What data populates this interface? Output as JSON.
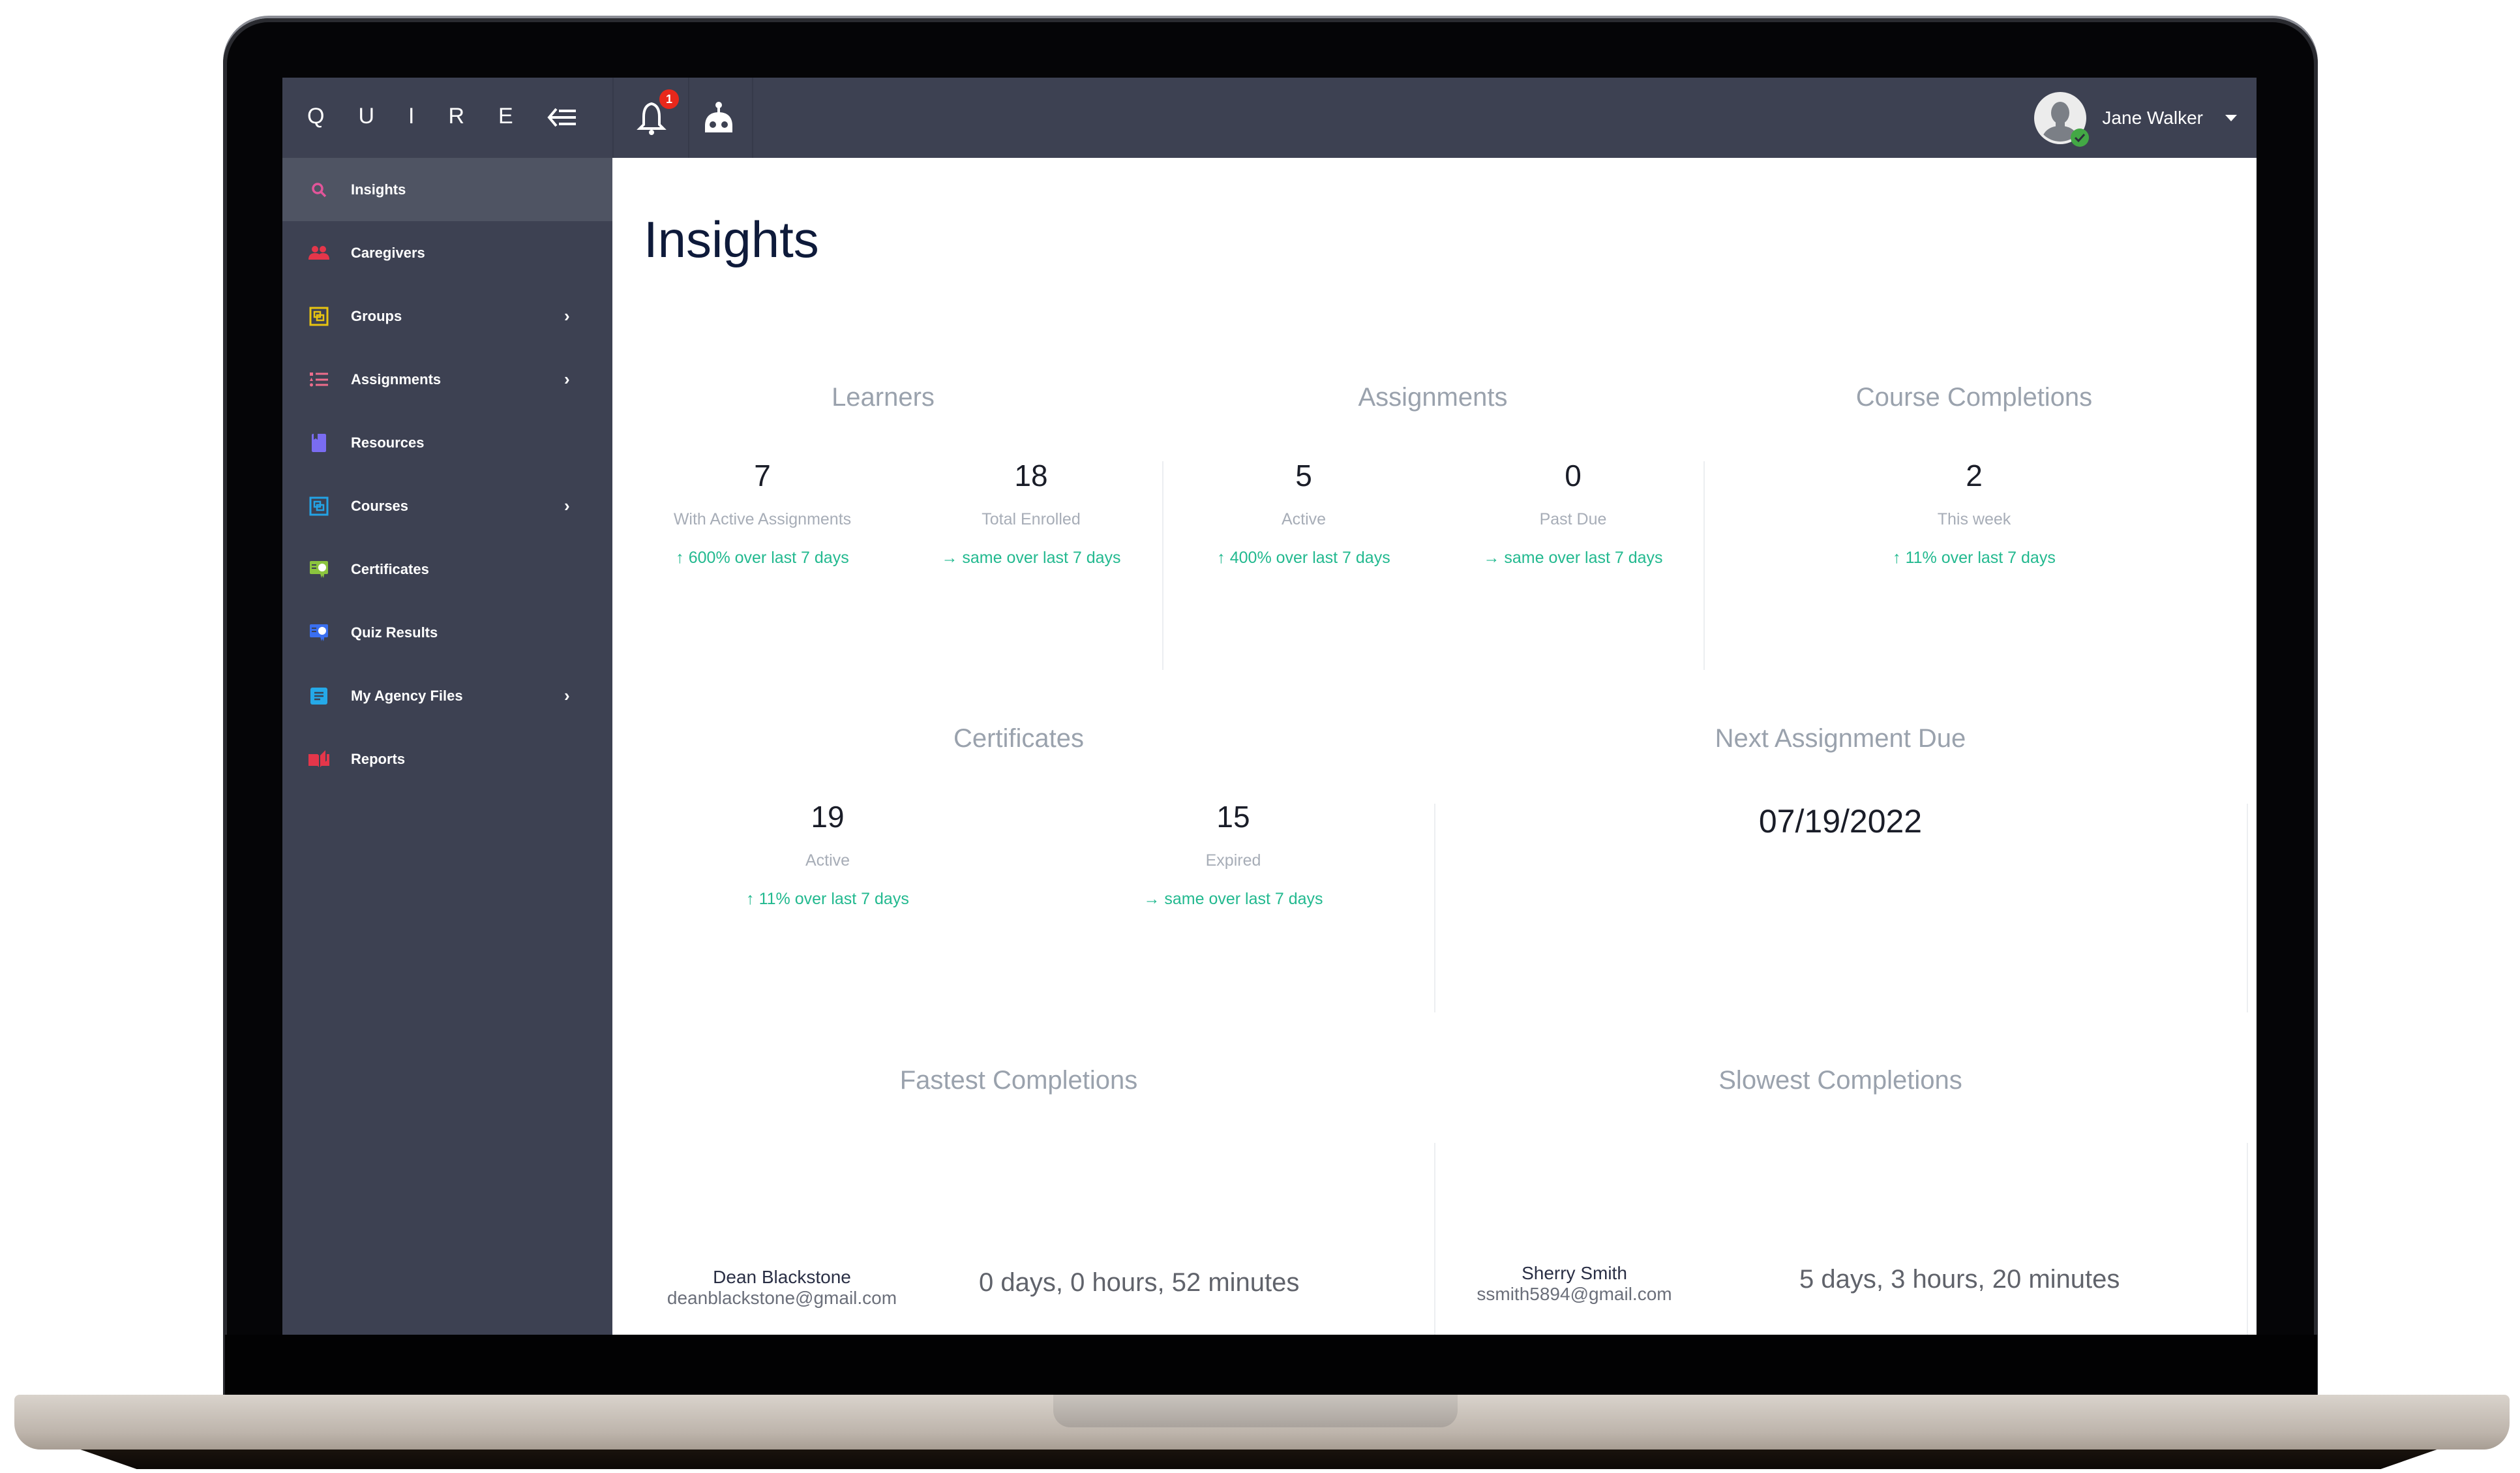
{
  "app": {
    "logo": "QUIRE",
    "notifications_count": "1",
    "user": {
      "name": "Jane Walker",
      "status": "online"
    }
  },
  "sidebar": {
    "items": [
      {
        "label": "Insights",
        "icon": "search-icon",
        "color": "#e2559a",
        "active": true,
        "has_submenu": false
      },
      {
        "label": "Caregivers",
        "icon": "people-icon",
        "color": "#e5364a",
        "active": false,
        "has_submenu": false
      },
      {
        "label": "Groups",
        "icon": "group-icon",
        "color": "#e8c410",
        "active": false,
        "has_submenu": true
      },
      {
        "label": "Assignments",
        "icon": "list-icon",
        "color": "#ee6d8c",
        "active": false,
        "has_submenu": true
      },
      {
        "label": "Resources",
        "icon": "bookmark-icon",
        "color": "#7a6cf2",
        "active": false,
        "has_submenu": false
      },
      {
        "label": "Courses",
        "icon": "course-icon",
        "color": "#23a3e6",
        "active": false,
        "has_submenu": true
      },
      {
        "label": "Certificates",
        "icon": "certificate-icon",
        "color": "#8bc43e",
        "active": false,
        "has_submenu": false
      },
      {
        "label": "Quiz Results",
        "icon": "quiz-icon",
        "color": "#3a6ff0",
        "active": false,
        "has_submenu": false
      },
      {
        "label": "My Agency Files",
        "icon": "file-icon",
        "color": "#25a9e8",
        "active": false,
        "has_submenu": true
      },
      {
        "label": "Reports",
        "icon": "book-icon",
        "color": "#e5364a",
        "active": false,
        "has_submenu": false
      }
    ]
  },
  "main": {
    "title": "Insights",
    "learners": {
      "title": "Learners",
      "stats": [
        {
          "value": "7",
          "label": "With Active Assignments",
          "trend": "600% over last 7 days",
          "trend_dir": "up"
        },
        {
          "value": "18",
          "label": "Total Enrolled",
          "trend": "same over last 7 days",
          "trend_dir": "same"
        }
      ]
    },
    "assignments": {
      "title": "Assignments",
      "stats": [
        {
          "value": "5",
          "label": "Active",
          "trend": "400% over last 7 days",
          "trend_dir": "up"
        },
        {
          "value": "0",
          "label": "Past Due",
          "trend": "same over last 7 days",
          "trend_dir": "same"
        }
      ]
    },
    "course_completions": {
      "title": "Course Completions",
      "stats": [
        {
          "value": "2",
          "label": "This week",
          "trend": "11% over last 7 days",
          "trend_dir": "up"
        }
      ]
    },
    "certificates": {
      "title": "Certificates",
      "stats": [
        {
          "value": "19",
          "label": "Active",
          "trend": "11% over last 7 days",
          "trend_dir": "up"
        },
        {
          "value": "15",
          "label": "Expired",
          "trend": "same over last 7 days",
          "trend_dir": "same"
        }
      ]
    },
    "next_assignment": {
      "title": "Next Assignment Due",
      "date": "07/19/2022"
    },
    "fastest": {
      "title": "Fastest Completions",
      "name": "Dean Blackstone",
      "email": "deanblackstone@gmail.com",
      "duration": "0 days, 0 hours, 52 minutes"
    },
    "slowest": {
      "title": "Slowest Completions",
      "name": "Sherry Smith",
      "email": "ssmith5894@gmail.com",
      "duration": "5 days, 3 hours, 20 minutes"
    }
  },
  "colors": {
    "trend": "#22b98f",
    "sidebar_bg": "#3d4152",
    "badge": "#e8281b",
    "online": "#43a845"
  }
}
